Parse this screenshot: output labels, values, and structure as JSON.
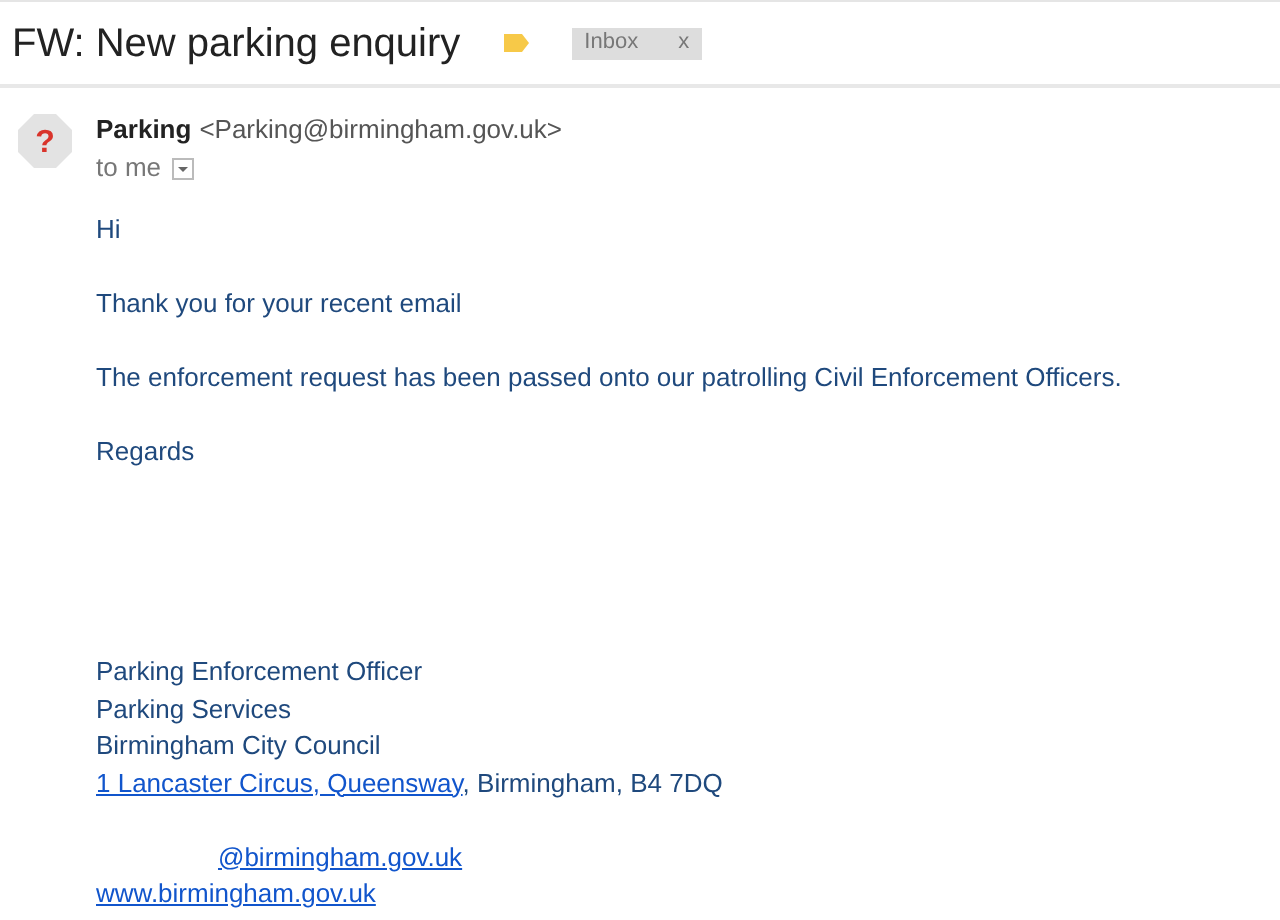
{
  "subject": "FW: New parking enquiry",
  "label": {
    "text": "Inbox",
    "remove": "x"
  },
  "sender": {
    "avatar": "?",
    "name": "Parking",
    "email": "<Parking@birmingham.gov.uk>"
  },
  "recipient": "to me",
  "body": [
    "Hi",
    "Thank you for your recent email",
    "The enforcement request has been passed onto our patrolling Civil Enforcement Officers.",
    "Regards"
  ],
  "signature": [
    {
      "kind": "text",
      "text": "Parking Enforcement Officer"
    },
    {
      "kind": "text",
      "text": "Parking Services"
    },
    {
      "kind": "text",
      "text": "Birmingham City Council"
    },
    {
      "kind": "address",
      "link": "1 Lancaster Circus, Queensway",
      "text": ", Birmingham, B4 7DQ"
    },
    {
      "kind": "gap"
    },
    {
      "kind": "email",
      "link": "@birmingham.gov.uk"
    },
    {
      "kind": "link",
      "link": "www.birmingham.gov.uk"
    }
  ]
}
